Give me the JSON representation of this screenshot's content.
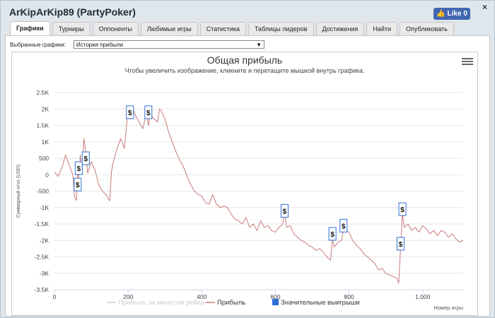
{
  "window": {
    "title": "ArKipArKip89 (PartyPoker)",
    "close_label": "×",
    "like_label": "Like 0"
  },
  "tabs": [
    {
      "label": "Графики",
      "active": true
    },
    {
      "label": "Турниры",
      "active": false
    },
    {
      "label": "Оппоненты",
      "active": false
    },
    {
      "label": "Любимые игры",
      "active": false
    },
    {
      "label": "Статистика",
      "active": false
    },
    {
      "label": "Таблицы лидеров",
      "active": false
    },
    {
      "label": "Достижения",
      "active": false
    },
    {
      "label": "Найти",
      "active": false
    },
    {
      "label": "Опубликовать",
      "active": false
    }
  ],
  "graph_select": {
    "label": "Выбранные графики:",
    "value": "История прибыли"
  },
  "chart_data": {
    "type": "line",
    "title": "Общая прибыль",
    "subtitle": "Чтобы увеличить изображение, кликните и перетащите мышкой внутрь графика.",
    "xlabel": "Номер игры",
    "ylabel": "Суммарный итог (USD)",
    "xlim": [
      0,
      1110
    ],
    "ylim": [
      -3500,
      2500
    ],
    "xticks": [
      "0",
      "200",
      "400",
      "600",
      "800",
      "1,000"
    ],
    "xtick_values": [
      0,
      200,
      400,
      600,
      800,
      1000
    ],
    "yticks": [
      "2.5K",
      "2K",
      "1.5K",
      "1K",
      "500",
      "0",
      "-500",
      "-1K",
      "-1.5K",
      "-2K",
      "-2.5K",
      "-3K",
      "-3.5K"
    ],
    "ytick_values": [
      2500,
      2000,
      1500,
      1000,
      500,
      0,
      -500,
      -1000,
      -1500,
      -2000,
      -2500,
      -3000,
      -3500
    ],
    "grid": true,
    "series": [
      {
        "name": "Прибыль",
        "color": "#c97b7b",
        "x": [
          0,
          10,
          20,
          30,
          40,
          50,
          55,
          60,
          63,
          66,
          70,
          75,
          80,
          85,
          90,
          100,
          110,
          120,
          130,
          140,
          150,
          155,
          160,
          170,
          180,
          190,
          200,
          205,
          210,
          215,
          220,
          230,
          240,
          250,
          255,
          260,
          270,
          280,
          285,
          290,
          300,
          310,
          320,
          330,
          340,
          350,
          360,
          370,
          380,
          390,
          400,
          410,
          420,
          430,
          440,
          450,
          460,
          470,
          480,
          490,
          500,
          510,
          520,
          530,
          540,
          550,
          560,
          570,
          580,
          590,
          600,
          610,
          620,
          625,
          630,
          640,
          650,
          660,
          670,
          680,
          690,
          700,
          710,
          720,
          730,
          740,
          750,
          755,
          760,
          770,
          780,
          785,
          790,
          800,
          810,
          820,
          830,
          840,
          850,
          860,
          870,
          880,
          890,
          900,
          910,
          920,
          930,
          935,
          940,
          945,
          950,
          960,
          970,
          980,
          990,
          1000,
          1010,
          1020,
          1030,
          1040,
          1050,
          1060,
          1070,
          1080,
          1090,
          1100,
          1110
        ],
        "y": [
          80,
          -50,
          200,
          600,
          300,
          0,
          -700,
          -780,
          200,
          -100,
          600,
          100,
          1100,
          700,
          50,
          400,
          150,
          -300,
          -500,
          -600,
          -800,
          100,
          400,
          800,
          1100,
          800,
          2000,
          1850,
          1900,
          1950,
          1800,
          1600,
          1400,
          1900,
          1500,
          1850,
          1700,
          1600,
          2000,
          1950,
          1700,
          1300,
          1000,
          700,
          450,
          250,
          -50,
          -300,
          -500,
          -600,
          -650,
          -850,
          -900,
          -600,
          -900,
          -1000,
          -950,
          -1000,
          -1200,
          -1350,
          -1400,
          -1500,
          -1300,
          -1600,
          -1500,
          -1700,
          -1400,
          -1600,
          -1550,
          -1700,
          -1750,
          -1600,
          -1500,
          -1100,
          -1600,
          -1550,
          -1800,
          -1900,
          -2000,
          -2050,
          -2150,
          -2200,
          -2300,
          -2250,
          -2350,
          -2500,
          -2600,
          -1950,
          -2200,
          -2050,
          -2000,
          -1600,
          -1700,
          -1750,
          -2000,
          -2150,
          -2250,
          -2400,
          -2500,
          -2600,
          -2700,
          -2900,
          -2850,
          -3000,
          -3050,
          -3100,
          -3150,
          -3300,
          -2200,
          -1200,
          -1600,
          -1500,
          -1700,
          -1600,
          -1750,
          -1550,
          -1650,
          -1800,
          -1700,
          -1850,
          -1700,
          -1750,
          -1900,
          -1800,
          -1950,
          -2050,
          -2000
        ]
      }
    ],
    "markers": {
      "name": "Значительные выигрыши",
      "symbol": "$",
      "points": [
        {
          "x": 63,
          "y": -300
        },
        {
          "x": 66,
          "y": 200
        },
        {
          "x": 85,
          "y": 500
        },
        {
          "x": 205,
          "y": 1900
        },
        {
          "x": 255,
          "y": 1900
        },
        {
          "x": 625,
          "y": -1100
        },
        {
          "x": 755,
          "y": -1800
        },
        {
          "x": 785,
          "y": -1550
        },
        {
          "x": 940,
          "y": -2100
        },
        {
          "x": 945,
          "y": -1050
        }
      ]
    },
    "legend": {
      "position": "bottom",
      "items": [
        {
          "label": "Прибыль за минусом рейка",
          "color": "#cfcfcf",
          "kind": "line",
          "hidden": true
        },
        {
          "label": "Прибыль",
          "color": "#c97b7b",
          "kind": "line",
          "hidden": false
        },
        {
          "label": "Значительные выигрыши",
          "color": "#2f6fd6",
          "kind": "box",
          "hidden": false
        }
      ]
    }
  }
}
